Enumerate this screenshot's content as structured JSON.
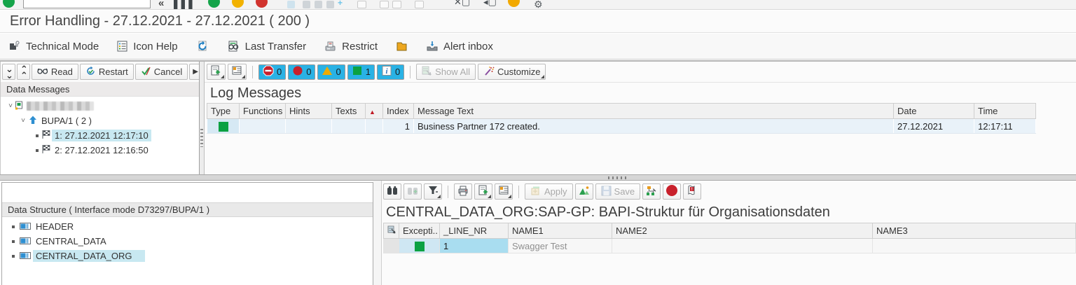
{
  "title_bar": {
    "title": "Error Handling - 27.12.2021 - 27.12.2021 ( 200 )"
  },
  "app_toolbar": {
    "technical_mode": "Technical Mode",
    "icon_help": "Icon Help",
    "last_transfer": "Last Transfer",
    "restrict": "Restrict",
    "alert_inbox": "Alert inbox"
  },
  "messages_panel": {
    "toolbar": {
      "read": "Read",
      "restart": "Restart",
      "cancel": "Cancel"
    },
    "header": "Data Messages",
    "tree": {
      "node_label": "BUPA/1 ( 2 )",
      "leaves": [
        {
          "label": "1: 27.12.2021 12:17:10"
        },
        {
          "label": "2: 27.12.2021 12:16:50"
        }
      ]
    }
  },
  "log_panel": {
    "chips": [
      {
        "icon": "stop-icon",
        "count": "0"
      },
      {
        "icon": "error-icon",
        "count": "0"
      },
      {
        "icon": "warning-icon",
        "count": "0"
      },
      {
        "icon": "success-icon",
        "count": "1"
      },
      {
        "icon": "info-icon",
        "count": "0"
      }
    ],
    "show_all": "Show All",
    "customize": "Customize",
    "title": "Log Messages",
    "table": {
      "columns": {
        "type": "Type",
        "functions": "Functions",
        "hints": "Hints",
        "texts": "Texts",
        "sort": "",
        "index": "Index",
        "message": "Message Text",
        "date": "Date",
        "time": "Time"
      },
      "rows": [
        {
          "index": "1",
          "message": "Business Partner 172 created.",
          "date": "27.12.2021",
          "time": "12:17:11"
        }
      ]
    }
  },
  "structure_panel": {
    "header": "Data Structure ( Interface mode D73297/BUPA/1 )",
    "items": [
      {
        "label": "HEADER"
      },
      {
        "label": "CENTRAL_DATA"
      },
      {
        "label": "CENTRAL_DATA_ORG"
      }
    ]
  },
  "detail_panel": {
    "toolbar": {
      "apply": "Apply",
      "save": "Save"
    },
    "title": "CENTRAL_DATA_ORG:SAP-GP: BAPI-Struktur für Organisationsdaten",
    "table": {
      "columns": {
        "exception": "Excepti..",
        "line_nr": "_LINE_NR",
        "name1": "NAME1",
        "name2": "NAME2",
        "name3": "NAME3"
      },
      "rows": [
        {
          "line_nr": "1",
          "name1": "Swagger Test",
          "name2": "",
          "name3": ""
        }
      ]
    }
  },
  "colors": {
    "accent_cyan": "#29b2e5",
    "status_green": "#0ba142",
    "status_red": "#c8202b",
    "status_yellow": "#f0ab00",
    "selection_blue": "#c8e8f1"
  }
}
